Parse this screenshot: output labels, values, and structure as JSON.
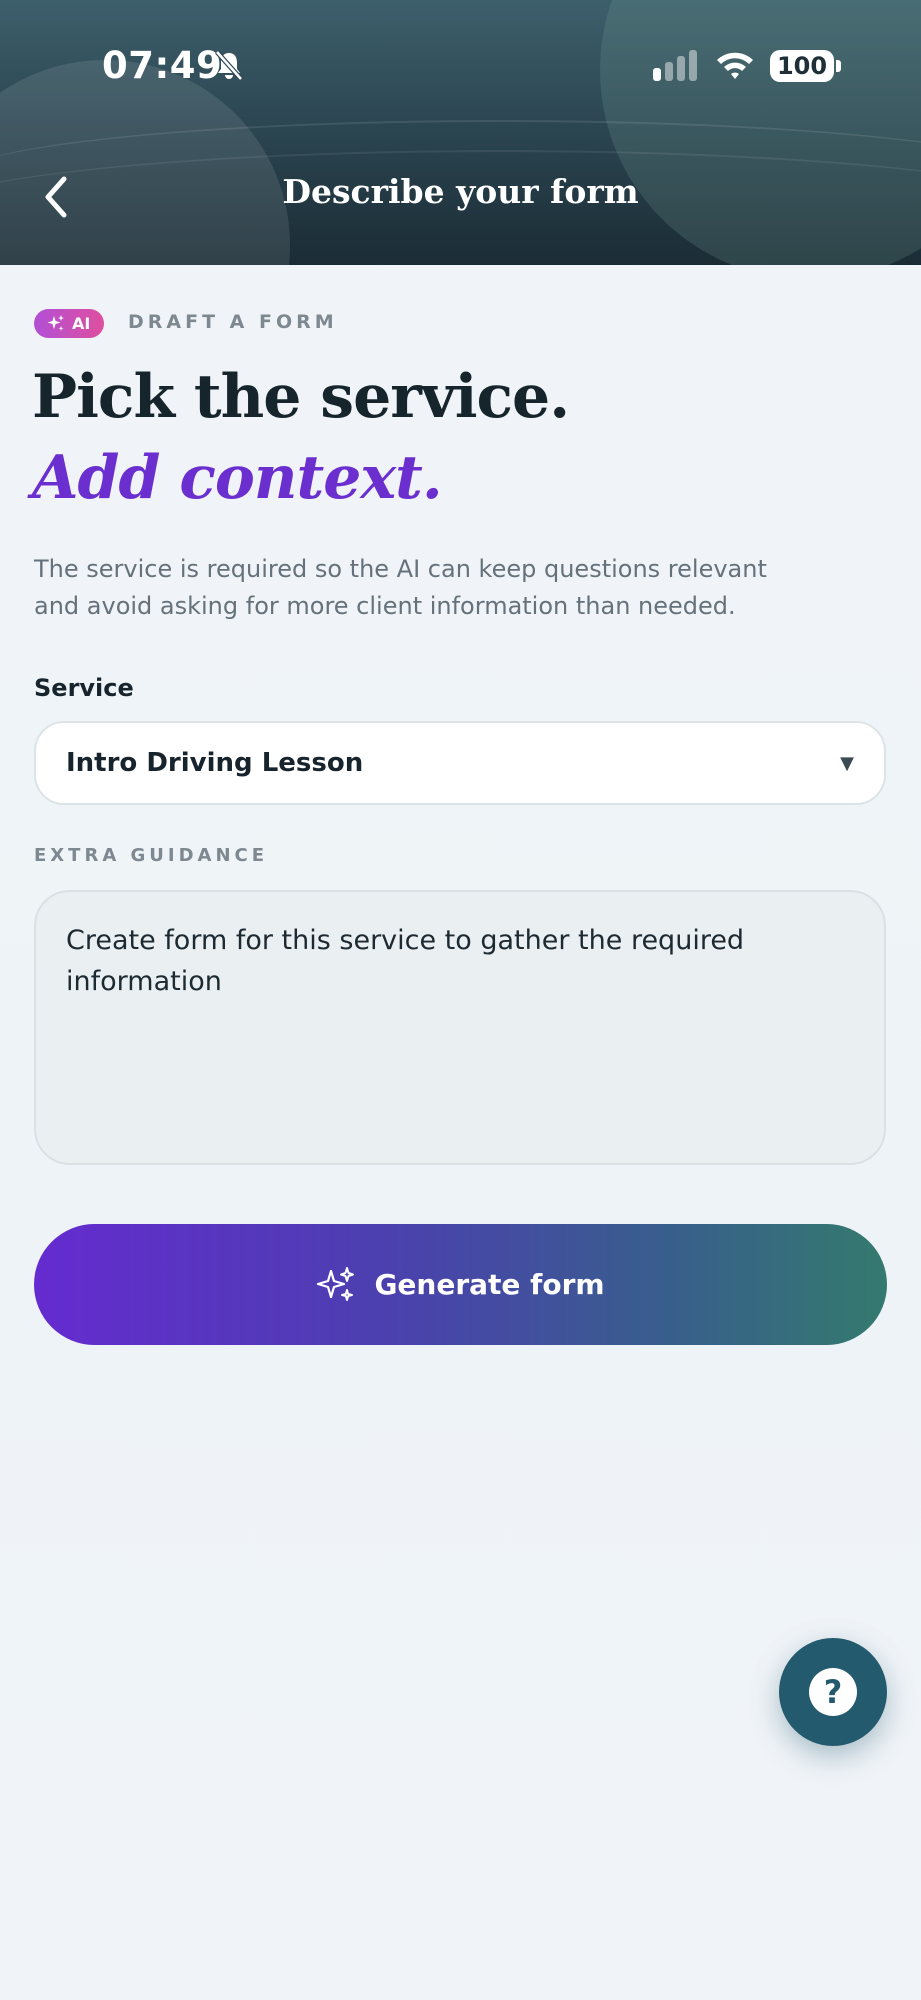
{
  "status_bar": {
    "time": "07:49",
    "battery": "100"
  },
  "header": {
    "title": "Describe your form"
  },
  "badge": {
    "label": "AI"
  },
  "eyebrow": "DRAFT A FORM",
  "headline": {
    "line1": "Pick the service.",
    "line2": "Add context."
  },
  "description": "The service is required so the AI can keep questions relevant and avoid asking for more client information than needed.",
  "service": {
    "label": "Service",
    "value": "Intro Driving Lesson"
  },
  "guidance": {
    "label": "EXTRA GUIDANCE",
    "value": "Create form for this service to gather the required information"
  },
  "actions": {
    "generate_label": "Generate form",
    "help_symbol": "?"
  },
  "icons": {
    "back": "back-chevron-icon",
    "bell": "bell-slash-icon",
    "signal": "cellular-signal-icon",
    "wifi": "wifi-icon",
    "sparkle": "sparkles-icon",
    "help": "question-icon"
  },
  "colors": {
    "accent_purple": "#6b2fcf",
    "badge_gradient_start": "#b24fd6",
    "badge_gradient_end": "#de4f9f",
    "button_gradient_start": "#652bd0",
    "button_gradient_end": "#347a6e",
    "help_button": "#245a6d",
    "header_dark": "#1b2c35"
  }
}
